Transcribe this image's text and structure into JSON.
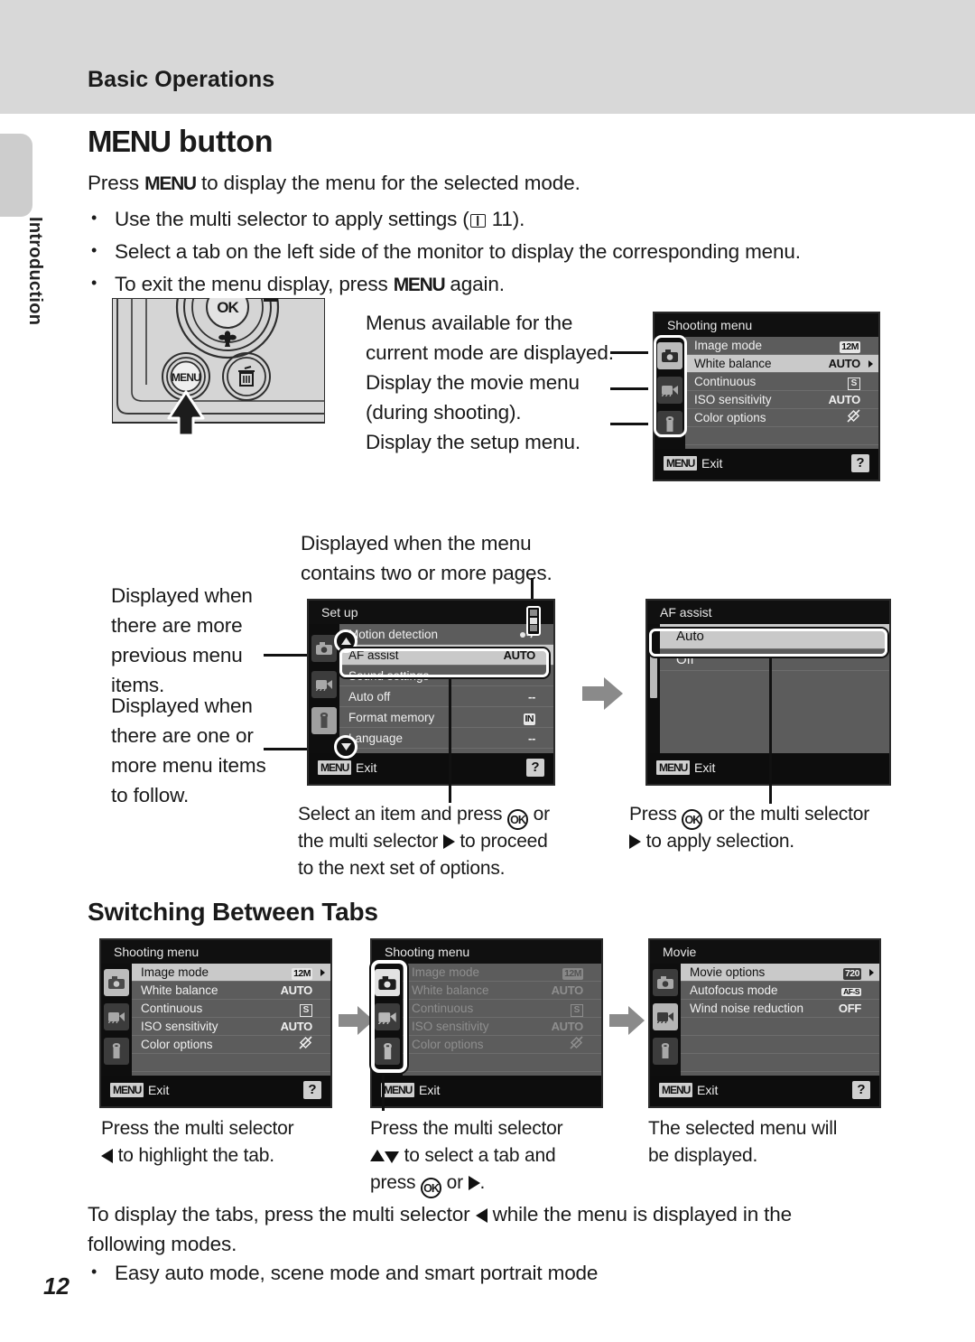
{
  "header": {
    "title": "Basic Operations"
  },
  "side_tab": {
    "label": "Introduction"
  },
  "page_number": "12",
  "section_menu_button": {
    "heading_menu": "MENU",
    "heading_rest": " button",
    "lead_pre": "Press ",
    "lead_menu": "MENU",
    "lead_post": " to display the menu for the selected mode.",
    "bullets": [
      {
        "pre": "Use the multi selector to apply settings (",
        "ref": "11",
        "post": ")."
      },
      {
        "pre": "Select a tab on the left side of the monitor to display the corresponding menu.",
        "ref": "",
        "post": ""
      },
      {
        "pre": "To exit the menu display, press ",
        "menu": "MENU",
        "post": " again."
      }
    ],
    "callouts": [
      "Menus available for the",
      "current mode are displayed.",
      "Display the movie menu",
      "(during shooting).",
      "Display the setup menu."
    ]
  },
  "camera_figure": {
    "menu_button_label": "MENU",
    "ok_button_label": "OK",
    "delete_icon": "trash-icon",
    "macro_icon": "macro-flower-icon"
  },
  "shooting_menu_top": {
    "title": "Shooting menu",
    "tabs": [
      "camera-icon",
      "movie-icon",
      "wrench-icon"
    ],
    "selected_tab": 0,
    "rows": [
      {
        "label": "Image mode",
        "value": "12M",
        "value_kind": "pill",
        "highlight": false,
        "caret": false
      },
      {
        "label": "White balance",
        "value": "AUTO",
        "value_kind": "text",
        "highlight": true,
        "caret": true
      },
      {
        "label": "Continuous",
        "value": "S",
        "value_kind": "box",
        "highlight": false,
        "caret": false
      },
      {
        "label": "ISO sensitivity",
        "value": "AUTO",
        "value_kind": "text",
        "highlight": false,
        "caret": false
      },
      {
        "label": "Color options",
        "value": "off",
        "value_kind": "colorx",
        "highlight": false,
        "caret": false
      }
    ],
    "footer_badge": "MENU",
    "footer_exit": "Exit",
    "help_badge": "?"
  },
  "setup_section": {
    "top_caption": [
      "Displayed when the menu",
      "contains two or more pages."
    ],
    "left_caption_1": [
      "Displayed when",
      "there are more",
      "previous menu",
      "items."
    ],
    "left_caption_2": [
      "Displayed when",
      "there are one or",
      "more menu items",
      "to follow."
    ],
    "setup_menu": {
      "title": "Set up",
      "rows": [
        {
          "label": "Motion detection",
          "value": "motion-icon",
          "value_kind": "icon",
          "highlight": false
        },
        {
          "label": "AF assist",
          "value": "AUTO",
          "value_kind": "text",
          "highlight": true
        },
        {
          "label": "Sound settings",
          "value": "--",
          "value_kind": "text",
          "highlight": false
        },
        {
          "label": "Auto off",
          "value": "--",
          "value_kind": "text",
          "highlight": false
        },
        {
          "label": "Format memory",
          "value": "IN",
          "value_kind": "pill",
          "highlight": false
        },
        {
          "label": "Language",
          "value": "--",
          "value_kind": "text",
          "highlight": false
        }
      ],
      "footer_badge": "MENU",
      "footer_exit": "Exit",
      "help_badge": "?",
      "scroll_up_icon": "triangle-up-icon",
      "scroll_down_icon": "triangle-down-icon",
      "page_indicator_icon": "page-bar-icon"
    },
    "af_assist_menu": {
      "title": "AF assist",
      "rows": [
        {
          "label": "Auto",
          "highlight": true
        },
        {
          "label": "Off",
          "highlight": false
        }
      ],
      "footer_badge": "MENU",
      "footer_exit": "Exit"
    },
    "caption_left": {
      "l1_pre": "Select an item and press ",
      "l1_ok": "OK",
      "l1_mid": " or",
      "l2_pre": "the multi selector ",
      "l2_post": " to proceed",
      "l3": "to the next set of options."
    },
    "caption_right": {
      "l1_pre": "Press ",
      "l1_ok": "OK",
      "l1_post": " or the multi selector",
      "l2_post": " to apply selection."
    }
  },
  "switching_tabs": {
    "heading": "Switching Between Tabs",
    "panel1": {
      "title": "Shooting menu",
      "selected_tab": 0,
      "rows": [
        {
          "label": "Image mode",
          "value": "12M",
          "value_kind": "pill",
          "highlight": true,
          "caret": true
        },
        {
          "label": "White balance",
          "value": "AUTO",
          "value_kind": "text",
          "highlight": false,
          "caret": false
        },
        {
          "label": "Continuous",
          "value": "S",
          "value_kind": "box",
          "highlight": false,
          "caret": false
        },
        {
          "label": "ISO sensitivity",
          "value": "AUTO",
          "value_kind": "text",
          "highlight": false,
          "caret": false
        },
        {
          "label": "Color options",
          "value": "off",
          "value_kind": "colorx",
          "highlight": false,
          "caret": false
        }
      ],
      "footer_badge": "MENU",
      "footer_exit": "Exit",
      "help_badge": "?"
    },
    "panel2": {
      "title": "Shooting menu",
      "selected_tab": 0,
      "tab_group_highlighted": true,
      "rows": [
        {
          "label": "Image mode",
          "value": "12M",
          "value_kind": "pill",
          "dim": true
        },
        {
          "label": "White balance",
          "value": "AUTO",
          "value_kind": "text",
          "dim": true
        },
        {
          "label": "Continuous",
          "value": "S",
          "value_kind": "box",
          "dim": true
        },
        {
          "label": "ISO sensitivity",
          "value": "AUTO",
          "value_kind": "text",
          "dim": true
        },
        {
          "label": "Color options",
          "value": "off",
          "value_kind": "colorx",
          "dim": true
        }
      ],
      "footer_badge": "MENU",
      "footer_exit": "Exit",
      "help_badge": ""
    },
    "panel3": {
      "title": "Movie",
      "selected_tab": 1,
      "rows": [
        {
          "label": "Movie options",
          "value": "720",
          "value_kind": "pill",
          "highlight": true,
          "caret": true
        },
        {
          "label": "Autofocus mode",
          "value": "AF-S",
          "value_kind": "pill",
          "highlight": false,
          "caret": false
        },
        {
          "label": "Wind noise reduction",
          "value": "OFF",
          "value_kind": "text",
          "highlight": false,
          "caret": false
        }
      ],
      "footer_badge": "MENU",
      "footer_exit": "Exit",
      "help_badge": "?"
    },
    "captions": [
      {
        "l1": "Press the multi selector",
        "l2_post": " to highlight the tab.",
        "l3": ""
      },
      {
        "l1": "Press the multi selector",
        "l2_post": " to select a tab and",
        "l3_pre": "press ",
        "l3_ok": "OK",
        "l3_post": " or "
      },
      {
        "l1": "The selected menu will",
        "l2_post": "be displayed.",
        "l3": ""
      }
    ]
  },
  "footer_text": {
    "p1_pre": "To display the tabs, press the multi selector ",
    "p1_post": " while the menu is displayed in the",
    "p2": "following modes.",
    "bullet": "Easy auto mode, scene mode and smart portrait mode"
  }
}
